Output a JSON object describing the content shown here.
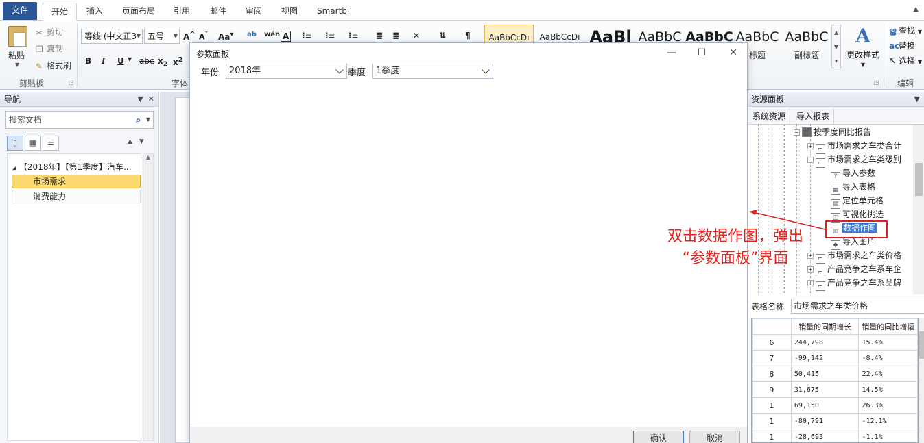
{
  "ribbon": {
    "tabs": [
      "文件",
      "开始",
      "插入",
      "页面布局",
      "引用",
      "邮件",
      "审阅",
      "视图",
      "Smartbi"
    ],
    "clipboard": {
      "paste": "粘贴",
      "cut": "剪切",
      "copy": "复制",
      "format_painter": "格式刷",
      "group": "剪贴板"
    },
    "font": {
      "name": "等线 (中文正文)",
      "name_display": "等线 (中文正3",
      "size": "五号",
      "group": "字体"
    },
    "styles": [
      "AaBbCcDı",
      "AaBbCcDı",
      "AaBl",
      "AaBbC",
      "AaBbC",
      "AaBbC",
      "AaBbC"
    ],
    "style_names": [
      "",
      "",
      "",
      "",
      "",
      "标题",
      "副标题"
    ],
    "change_styles": "更改样式",
    "editing": {
      "find": "查找",
      "replace": "替换",
      "select": "选择",
      "group": "编辑"
    }
  },
  "nav": {
    "title": "导航",
    "search_placeholder": "搜索文档",
    "root": "【2018年】【第1季度】汽车...",
    "items": [
      "市场需求",
      "消费能力"
    ]
  },
  "dialog": {
    "title": "参数面板",
    "year_label": "年份",
    "year_value": "2018年",
    "quarter_label": "季度",
    "quarter_value": "1季度",
    "ok": "确认",
    "cancel": "取消"
  },
  "resource": {
    "title": "资源面板",
    "tabs": [
      "系统资源",
      "导入报表"
    ],
    "tree": [
      "按季度同比报告",
      "市场需求之车类合计",
      "市场需求之车类级别",
      "导入参数",
      "导入表格",
      "定位单元格",
      "可视化挑选",
      "数据作图",
      "导入图片",
      "市场需求之车类价格",
      "产品竞争之车系车企",
      "产品竞争之车系品牌"
    ],
    "table_name_label": "表格名称",
    "table_name_value": "市场需求之车类价格",
    "columns": [
      "销量的同期增长",
      "销量的同比增幅"
    ],
    "rows": [
      {
        "idx": "6",
        "growth": "244,798",
        "rate": "15.4%"
      },
      {
        "idx": "7",
        "growth": "-99,142",
        "rate": "-8.4%"
      },
      {
        "idx": "8",
        "growth": "50,415",
        "rate": "22.4%"
      },
      {
        "idx": "9",
        "growth": "31,675",
        "rate": "14.5%"
      },
      {
        "idx": "1",
        "growth": "69,150",
        "rate": "26.3%"
      },
      {
        "idx": "1",
        "growth": "-80,791",
        "rate": "-12.1%"
      },
      {
        "idx": "1",
        "growth": "-28,693",
        "rate": "-1.1%"
      }
    ]
  },
  "annotation": {
    "line1": "双击数据作图，弹出",
    "line2": "“参数面板”界面",
    "color": "#e8231d"
  },
  "colors": {
    "file_tab": "#2b5797",
    "selection": "#fbd96f",
    "highlight": "#3d7bd2"
  }
}
